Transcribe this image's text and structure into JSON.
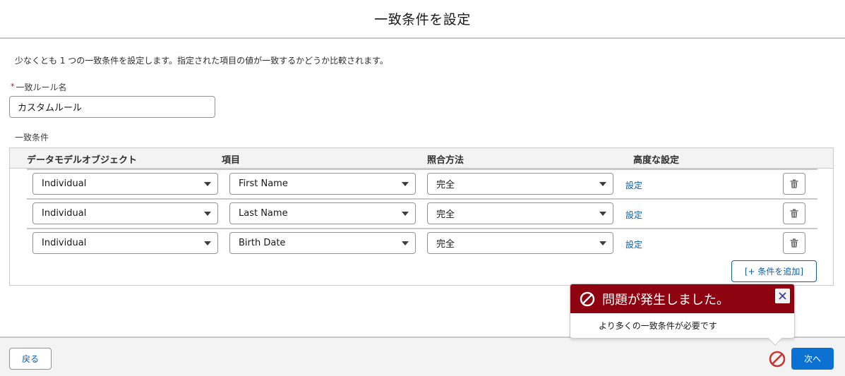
{
  "header": {
    "title": "一致条件を設定"
  },
  "description": "少なくとも 1 つの一致条件を設定します。指定された項目の値が一致するかどうか比較されます。",
  "rule_name": {
    "required_marker": "*",
    "label": "一致ルール名",
    "value": "カスタムルール"
  },
  "criteria": {
    "label": "一致条件",
    "columns": [
      "データモデルオブジェクト",
      "項目",
      "照合方法",
      "高度な設定"
    ],
    "rows": [
      {
        "object": "Individual",
        "field": "First Name",
        "method": "完全",
        "advanced_link": "設定"
      },
      {
        "object": "Individual",
        "field": "Last Name",
        "method": "完全",
        "advanced_link": "設定"
      },
      {
        "object": "Individual",
        "field": "Birth Date",
        "method": "完全",
        "advanced_link": "設定"
      }
    ],
    "add_button": "[+ 条件を追加]"
  },
  "error_popover": {
    "title": "問題が発生しました。",
    "message": "より多くの一致条件が必要です"
  },
  "footer": {
    "back_label": "戻る",
    "next_label": "次へ"
  },
  "colors": {
    "brand": "#0b72d4",
    "link": "#0b5cab",
    "error": "#8e030f",
    "error_icon": "#c23934"
  },
  "icons": [
    "chevron-down-icon",
    "trash-icon",
    "ban-icon",
    "close-icon"
  ]
}
